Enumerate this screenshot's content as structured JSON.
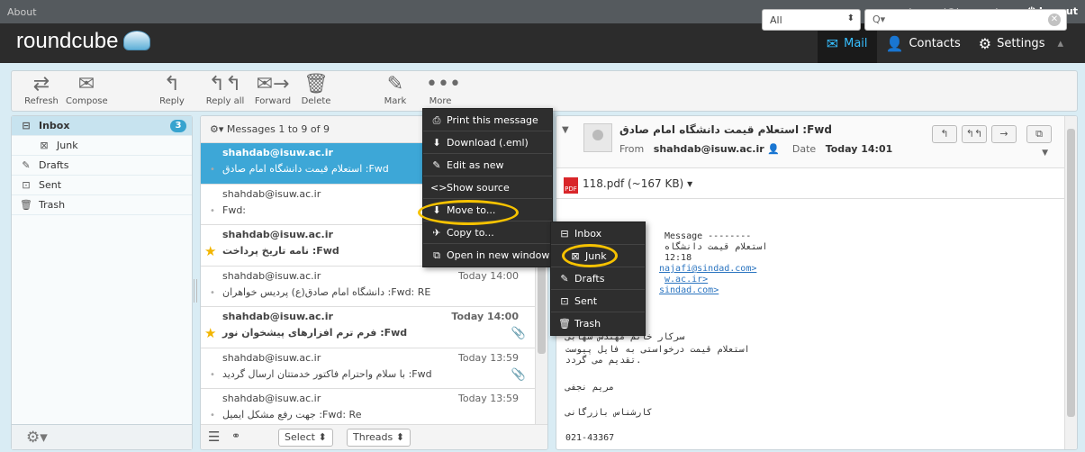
{
  "topline": {
    "about": "About",
    "user": "bornaei@isuw.ac.ir",
    "logout": "Logout"
  },
  "brand": {
    "name": "roundcube"
  },
  "nav": {
    "mail": "Mail",
    "contacts": "Contacts",
    "settings": "Settings"
  },
  "toolbar": {
    "refresh": "Refresh",
    "compose": "Compose",
    "reply": "Reply",
    "reply_all": "Reply all",
    "forward": "Forward",
    "delete": "Delete",
    "mark": "Mark",
    "more": "More",
    "filter": "All",
    "search_placeholder": "Q▾"
  },
  "folders": [
    {
      "label": "Inbox",
      "count": "3"
    },
    {
      "label": "Junk"
    },
    {
      "label": "Drafts"
    },
    {
      "label": "Sent"
    },
    {
      "label": "Trash"
    }
  ],
  "list": {
    "header": "Messages 1 to 9 of 9",
    "messages": [
      {
        "from": "shahdab@isuw.ac.ir",
        "subject": "استعلام قيمت دانشگاه امام صادق :Fwd",
        "date": ""
      },
      {
        "from": "shahdab@isuw.ac.ir",
        "subject": "Fwd:",
        "date": ""
      },
      {
        "from": "shahdab@isuw.ac.ir",
        "subject": "نامه تاریخ پرداخت :Fwd",
        "date": ""
      },
      {
        "from": "shahdab@isuw.ac.ir",
        "subject": "دانشگاه امام صادق(ع) پردیس خواهران :Fwd: RE",
        "date": "Today 14:00"
      },
      {
        "from": "shahdab@isuw.ac.ir",
        "subject": "فرم ترم افزارهای پیشخوان نور :Fwd",
        "date": "Today 14:00"
      },
      {
        "from": "shahdab@isuw.ac.ir",
        "subject": "با سلام واحترام فاکتور خدمتتان ارسال گردید :Fwd",
        "date": "Today 13:59"
      },
      {
        "from": "shahdab@isuw.ac.ir",
        "subject": "جهت رفع مشکل ایمیل :Fwd: Re",
        "date": "Today 13:59"
      }
    ],
    "select": "Select",
    "threads": "Threads"
  },
  "preview": {
    "subject": "استعلام قيمت دانشگاه امام صادق :Fwd",
    "from_label": "From",
    "from": "shahdab@isuw.ac.ir",
    "date_label": "Date",
    "date": "Today 14:01",
    "attachment": "118.pdf (~167 KB)",
    "body": [
      "Message --------",
      "استعلام قيمت دانشگاه",
      "12:18",
      "najafi@sindad.com>",
      "w.ac.ir>",
      "sindad.com>",
      "سرکار خانم مهندس شهابی",
      "استعلام قیمت درخواستی به فایل پیوست",
      "تقدیم می گردد.",
      "مریم نجفی",
      "کارشناس بازرگانی",
      "021-43367"
    ]
  },
  "more_menu": [
    {
      "label": "Print this message"
    },
    {
      "label": "Download (.eml)"
    },
    {
      "label": "Edit as new"
    },
    {
      "label": "Show source"
    },
    {
      "label": "Move to..."
    },
    {
      "label": "Copy to..."
    },
    {
      "label": "Open in new window"
    }
  ],
  "folder_menu": [
    {
      "label": "Inbox"
    },
    {
      "label": "Junk"
    },
    {
      "label": "Drafts"
    },
    {
      "label": "Sent"
    },
    {
      "label": "Trash"
    }
  ],
  "colors": {
    "accent": "#3da7d7",
    "highlight": "#f6c200",
    "menu_bg": "#2e2e2e"
  }
}
